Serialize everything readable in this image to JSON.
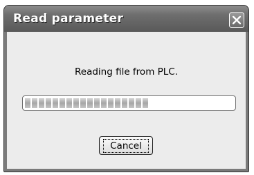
{
  "dialog": {
    "title": "Read parameter",
    "close_icon": "close-icon",
    "message": "Reading file from PLC.",
    "progress_fraction": 0.6,
    "cancel_label": "Cancel"
  }
}
